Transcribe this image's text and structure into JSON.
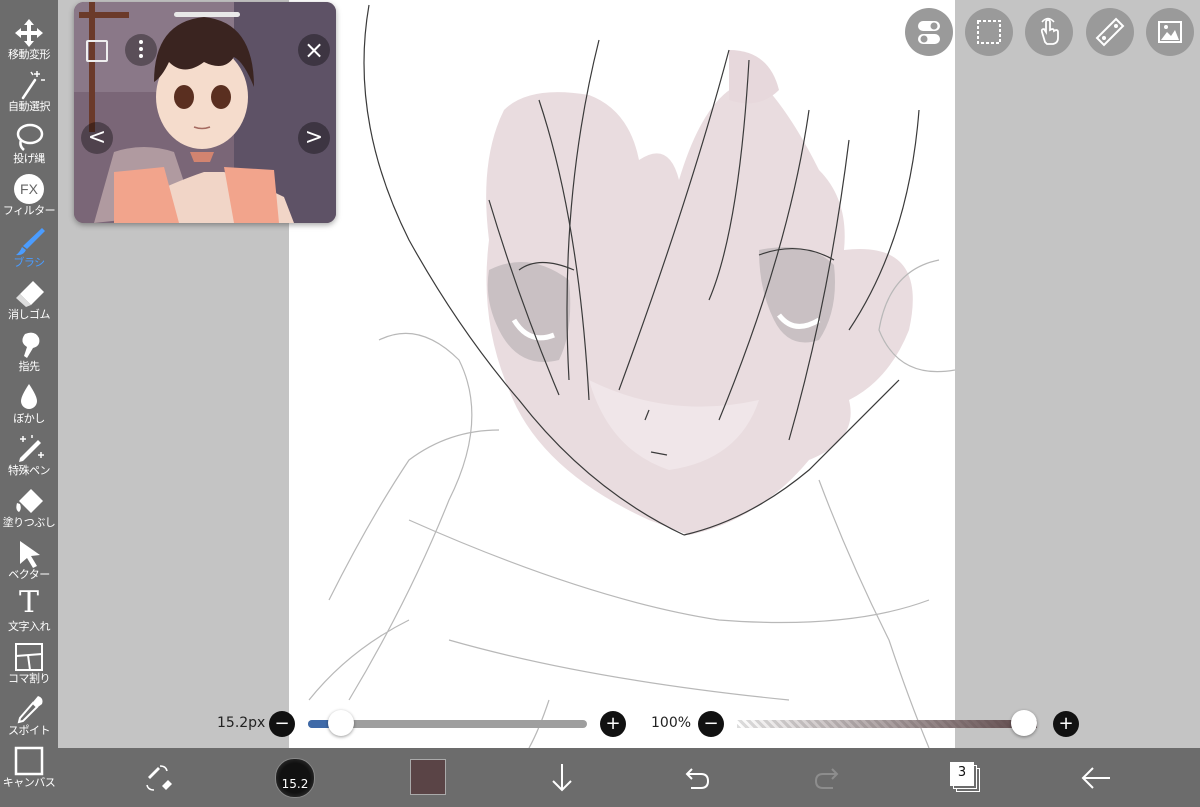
{
  "toolbar": {
    "items": [
      {
        "label": "移動変形",
        "icon": "move-icon"
      },
      {
        "label": "自動選択",
        "icon": "magic-wand-icon"
      },
      {
        "label": "投げ縄",
        "icon": "lasso-icon"
      },
      {
        "label": "フィルター",
        "icon": "fx-icon"
      },
      {
        "label": "ブラシ",
        "icon": "brush-icon"
      },
      {
        "label": "消しゴム",
        "icon": "eraser-icon"
      },
      {
        "label": "指先",
        "icon": "smudge-icon"
      },
      {
        "label": "ぼかし",
        "icon": "blur-drop-icon"
      },
      {
        "label": "特殊ペン",
        "icon": "special-pen-icon"
      },
      {
        "label": "塗りつぶし",
        "icon": "fill-icon"
      },
      {
        "label": "ベクター",
        "icon": "vector-arrow-icon"
      },
      {
        "label": "文字入れ",
        "icon": "text-icon"
      },
      {
        "label": "コマ割り",
        "icon": "frame-divider-icon"
      },
      {
        "label": "スポイト",
        "icon": "eyedropper-icon"
      },
      {
        "label": "キャンバス",
        "icon": "canvas-icon"
      }
    ],
    "active_index": 4,
    "fx_text": "FX",
    "text_glyph": "T"
  },
  "reference_window": {
    "prev_glyph": "<",
    "next_glyph": ">",
    "close_glyph": "×"
  },
  "top_right_buttons": [
    "toggle-icon",
    "selection-icon",
    "hand-touch-icon",
    "ruler-icon",
    "image-icon"
  ],
  "brush_size": {
    "label": "15.2px",
    "minus": "−",
    "plus": "+",
    "level": 0.08
  },
  "opacity": {
    "label": "100%",
    "minus": "−",
    "plus": "+",
    "level": 1.0
  },
  "bottom_bar": {
    "brush_preview_value": "15.2",
    "color_swatch": "#5a4446",
    "layer_count": "3",
    "items": [
      "swap-brush-eraser-icon",
      "brush-size-preview",
      "color-swatch",
      "download-arrow-icon",
      "undo-icon",
      "redo-icon",
      "layers-icon",
      "back-arrow-icon"
    ]
  },
  "colors": {
    "accent": "#4a9cff",
    "slider_blue": "#3f6aa8",
    "toolbar_bg": "#6c6c6c",
    "workspace_bg": "#c4c4c4"
  }
}
